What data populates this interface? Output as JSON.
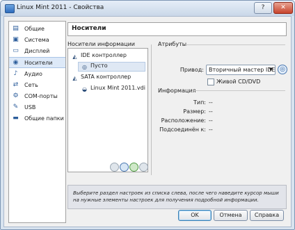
{
  "window": {
    "title": "Linux Mint 2011 - Свойства",
    "help_glyph": "?",
    "close_glyph": "✕"
  },
  "sidebar": {
    "items": [
      {
        "label": "Общие",
        "icon": "general-icon",
        "glyph": "▤"
      },
      {
        "label": "Система",
        "icon": "system-icon",
        "glyph": "▣"
      },
      {
        "label": "Дисплей",
        "icon": "display-icon",
        "glyph": "▭"
      },
      {
        "label": "Носители",
        "icon": "storage-icon",
        "glyph": "◉",
        "selected": true
      },
      {
        "label": "Аудио",
        "icon": "audio-icon",
        "glyph": "♪"
      },
      {
        "label": "Сеть",
        "icon": "network-icon",
        "glyph": "⇄"
      },
      {
        "label": "COM-порты",
        "icon": "serial-port-icon",
        "glyph": "⚙"
      },
      {
        "label": "USB",
        "icon": "usb-icon",
        "glyph": "✎"
      },
      {
        "label": "Общие папки",
        "icon": "shared-folders-icon",
        "glyph": "▬"
      }
    ]
  },
  "header": {
    "title": "Носители"
  },
  "storage_tree": {
    "section_title": "Носители информации",
    "rows": [
      {
        "label": "IDE контроллер",
        "icon": "ide-controller-icon",
        "glyph": "◭",
        "indent": 0
      },
      {
        "label": "Пусто",
        "icon": "optical-disc-icon",
        "glyph": "◎",
        "indent": 1,
        "selected": true
      },
      {
        "label": "SATA контроллер",
        "icon": "sata-controller-icon",
        "glyph": "◭",
        "indent": 0
      },
      {
        "label": "Linux Mint 2011.vdi",
        "icon": "hard-disk-icon",
        "glyph": "◒",
        "indent": 1
      }
    ]
  },
  "attributes": {
    "section_title": "Атрибуты",
    "drive_label": "Привод:",
    "drive_value": "Вторичный мастер IDE",
    "drive_arrow": "▼",
    "disc_icon_glyph": "◎",
    "live_cd_label": "Живой CD/DVD",
    "live_cd_checked": false
  },
  "information": {
    "section_title": "Информация",
    "rows": [
      {
        "label": "Тип:",
        "value": "--"
      },
      {
        "label": "Размер:",
        "value": "--"
      },
      {
        "label": "Расположение:",
        "value": "--"
      },
      {
        "label": "Подсоединён к:",
        "value": "--"
      }
    ]
  },
  "info_panel": {
    "text": "Выберите раздел настроек из списка слева, после чего наведите курсор мыши на нужные элементы настроек для получения подробной информации."
  },
  "buttons": {
    "ok": "OK",
    "cancel": "Отмена",
    "help": "Справка"
  }
}
